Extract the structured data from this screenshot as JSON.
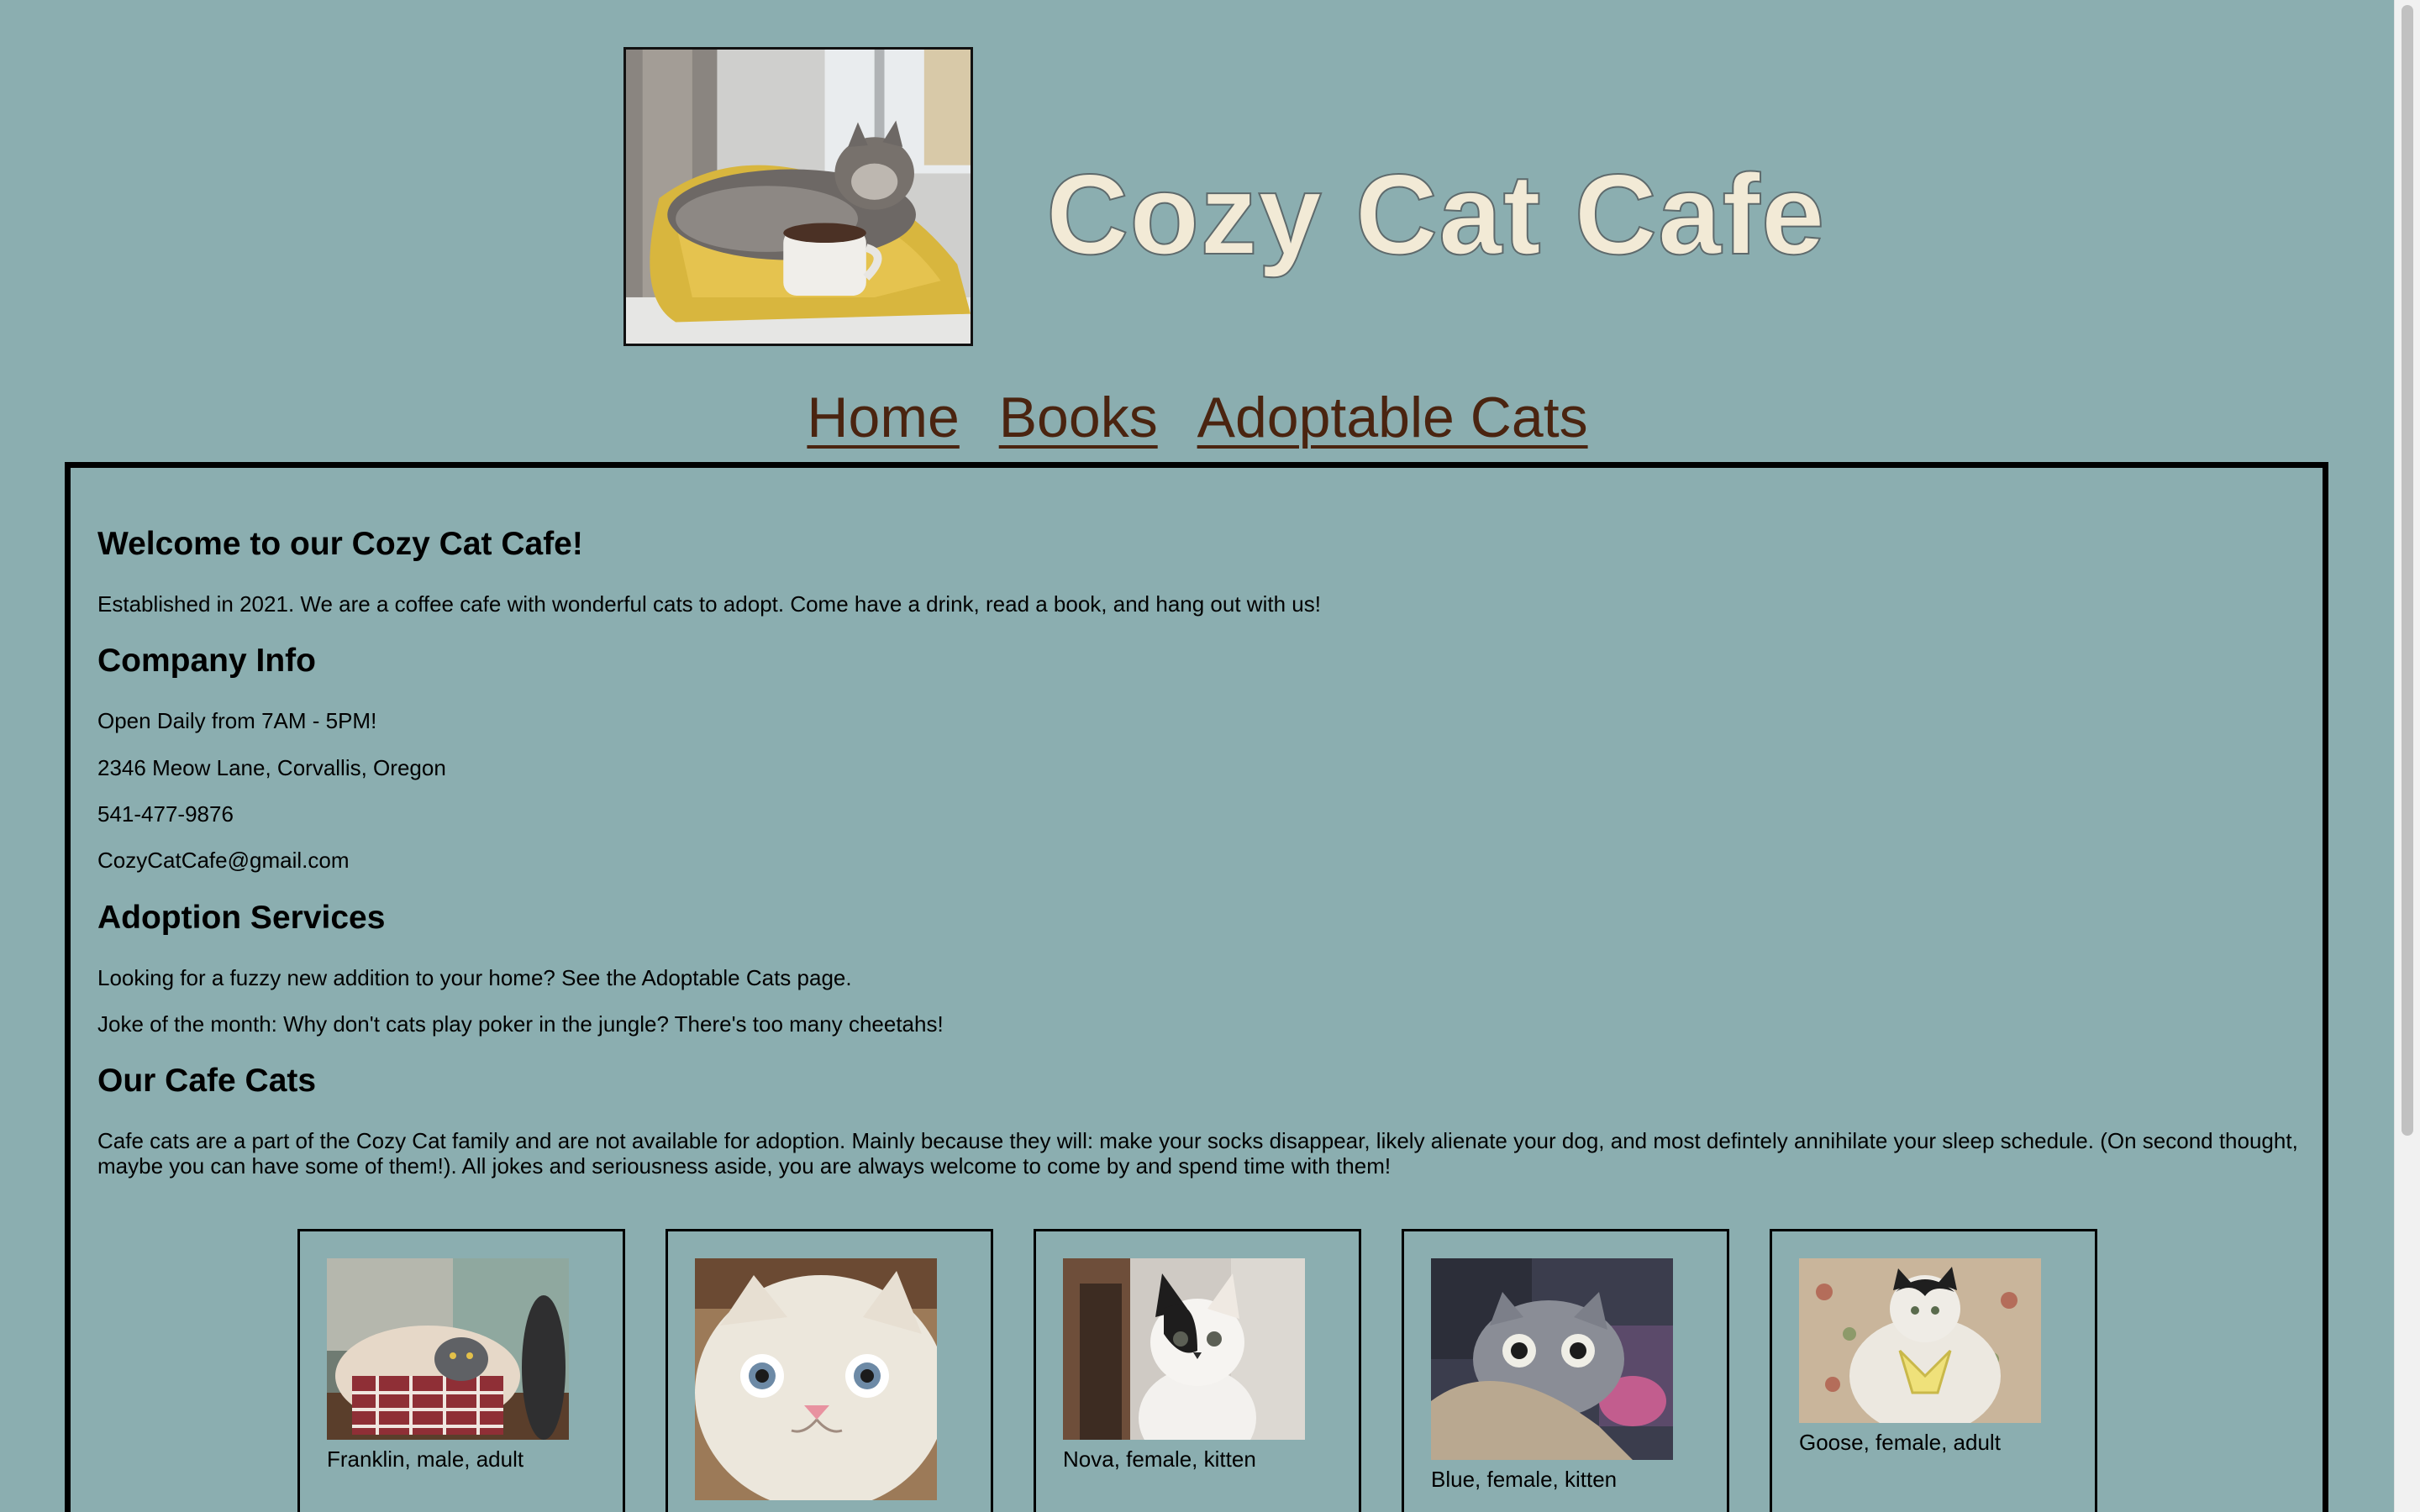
{
  "header": {
    "title": "Cozy Cat Cafe",
    "hero_alt": "cat lounging on a yellow blanket next to a coffee cup"
  },
  "nav": {
    "items": [
      "Home",
      "Books",
      "Adoptable Cats"
    ]
  },
  "welcome": {
    "heading": "Welcome to our Cozy Cat Cafe!",
    "text": "Established in 2021. We are a coffee cafe with wonderful cats to adopt. Come have a drink, read a book, and hang out with us!"
  },
  "company_info": {
    "heading": "Company Info",
    "hours": "Open Daily from 7AM - 5PM!",
    "address": "2346 Meow Lane, Corvallis, Oregon",
    "phone": "541-477-9876",
    "email": "CozyCatCafe@gmail.com"
  },
  "adoption": {
    "heading": "Adoption Services",
    "text": "Looking for a fuzzy new addition to your home? See the Adoptable Cats page.",
    "joke": "Joke of the month: Why don't cats play poker in the jungle? There's too many cheetahs!"
  },
  "cafe_cats": {
    "heading": "Our Cafe Cats",
    "text": "Cafe cats are a part of the Cozy Cat family and are not available for adoption. Mainly because they will: make your socks disappear, likely alienate your dog, and most defintely annihilate your sleep schedule. (On second thought, maybe you can have some of them!). All jokes and seriousness aside, you are always welcome to come by and spend time with them!",
    "cats": [
      {
        "caption": "Franklin, male, adult"
      },
      {
        "caption": ""
      },
      {
        "caption": "Nova, female, kitten"
      },
      {
        "caption": "Blue, female, kitten"
      },
      {
        "caption": "Goose, female, adult"
      }
    ]
  },
  "colors": {
    "page_bg": "#8baeb0",
    "title": "#f2ead6",
    "nav_link": "#4a2410",
    "border": "#000000"
  }
}
